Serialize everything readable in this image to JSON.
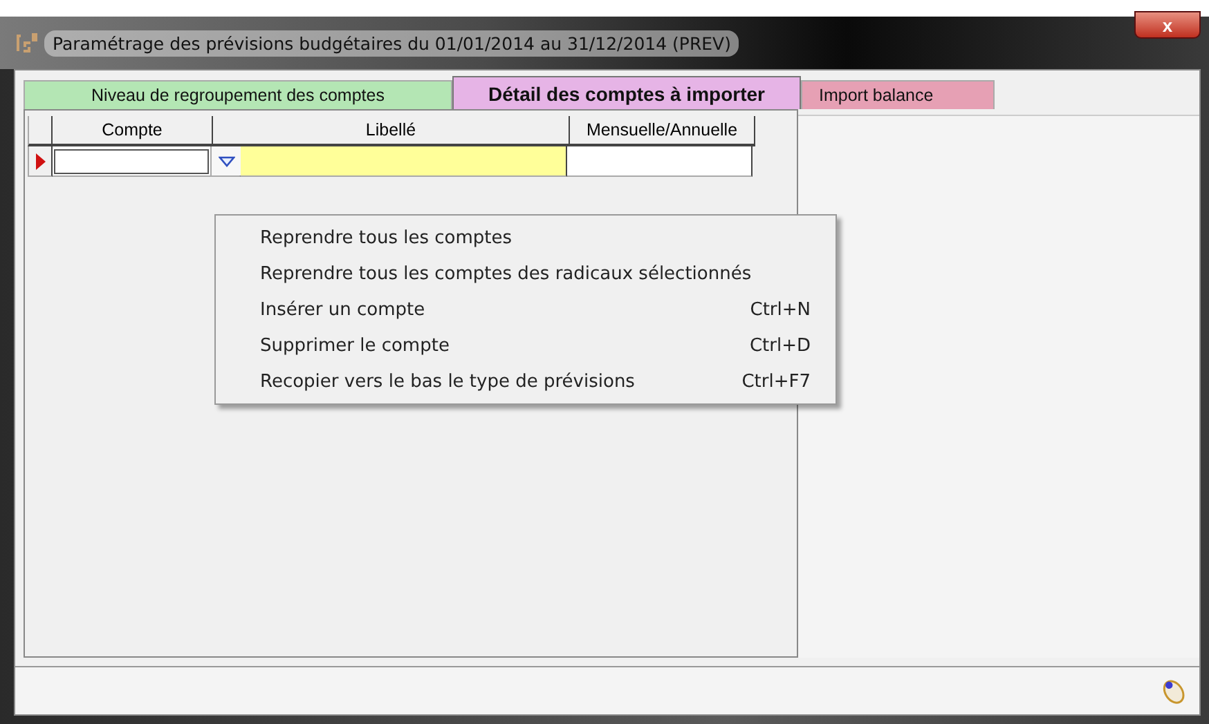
{
  "window": {
    "title": "Paramétrage des prévisions budgétaires du 01/01/2014 au 31/12/2014 (PREV)",
    "close": "x"
  },
  "tabs": [
    {
      "label": "Niveau de regroupement des comptes",
      "selected": false,
      "color": "#b4e6b4"
    },
    {
      "label": "Détail des comptes à importer",
      "selected": true,
      "color": "#e6b4e6"
    },
    {
      "label": "Import balance",
      "selected": false,
      "color": "#e6a0b4"
    }
  ],
  "table": {
    "columns": [
      "Compte",
      "Libellé",
      "Mensuelle/Annuelle"
    ],
    "rows": [
      {
        "selected": true,
        "cells": [
          "",
          "",
          ""
        ]
      }
    ]
  },
  "context_menu": [
    {
      "label": "Reprendre tous les comptes"
    },
    {
      "label": "Reprendre tous les comptes des radicaux sélectionnés"
    },
    {
      "label": "Insérer un compte",
      "shortcut": "Ctrl+N"
    },
    {
      "label": "Supprimer le compte",
      "shortcut": "Ctrl+D"
    },
    {
      "label": "Recopier vers le bas le type de prévisions",
      "shortcut": "Ctrl+F7"
    }
  ]
}
